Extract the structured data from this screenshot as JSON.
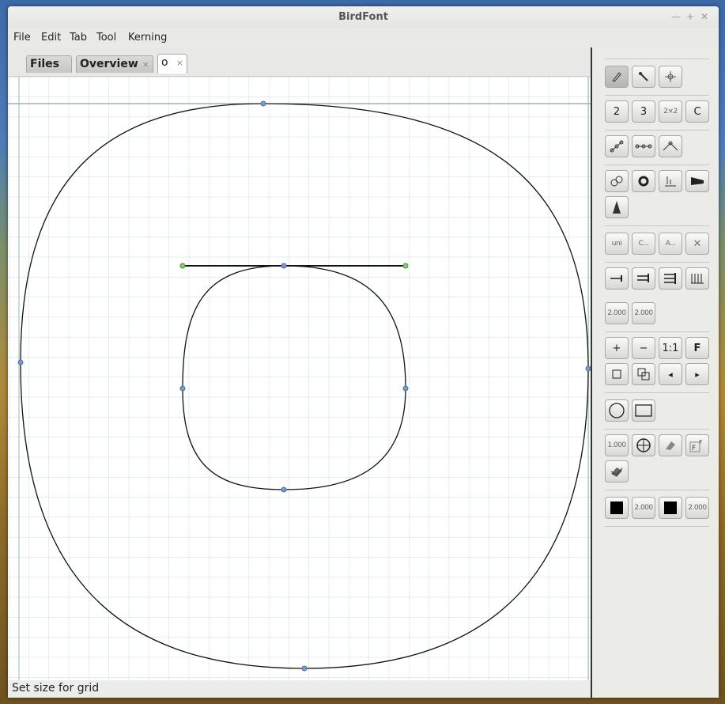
{
  "window": {
    "title": "BirdFont"
  },
  "menu": [
    "File",
    "Edit",
    "Tab",
    "Tool",
    "Kerning"
  ],
  "tabs": [
    {
      "label": "Files",
      "closable": false
    },
    {
      "label": "Overview",
      "closable": true,
      "close": "×"
    },
    {
      "label": "o",
      "closable": true,
      "close": "×",
      "active": true
    }
  ],
  "toolbox": {
    "grid": [
      "2",
      "3",
      "2×2",
      "C"
    ],
    "glyph_tools": [
      "uni",
      "C...",
      "A...",
      "✕"
    ],
    "stroke_widths": [
      "2.000",
      "2.000"
    ],
    "zoom": [
      "+",
      "−",
      "1:1",
      "F"
    ],
    "zoom_nav": [
      "◂",
      "▸"
    ],
    "guide_width": "1.000",
    "fill_row": [
      "2.000",
      "2.000"
    ]
  },
  "status": {
    "text": "Set size for grid"
  },
  "colors": {
    "grid": "#c7dee0",
    "guide": "#6f8c92",
    "point": "#7a9cc6",
    "handle": "#8ccc6a"
  }
}
